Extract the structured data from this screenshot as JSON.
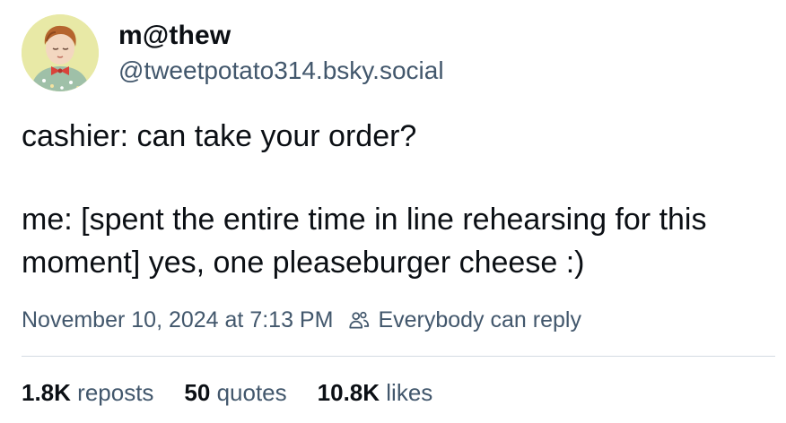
{
  "author": {
    "display_name": "m@thew",
    "handle": "@tweetpotato314.bsky.social",
    "avatar_icon": "avatar-child-with-bowtie"
  },
  "post": {
    "lines": [
      "cashier: can take your order?",
      "me: [spent the entire time in line rehearsing for this moment] yes, one pleaseburger cheese :)"
    ]
  },
  "meta": {
    "timestamp": "November 10, 2024 at 7:13 PM",
    "reply_setting": "Everybody can reply",
    "reply_icon": "people-icon"
  },
  "stats": {
    "reposts_count": "1.8K",
    "reposts_label": "reposts",
    "quotes_count": "50",
    "quotes_label": "quotes",
    "likes_count": "10.8K",
    "likes_label": "likes"
  },
  "colors": {
    "text": "#0b0f14",
    "secondary": "#42576c",
    "divider": "#d4dbe2"
  }
}
